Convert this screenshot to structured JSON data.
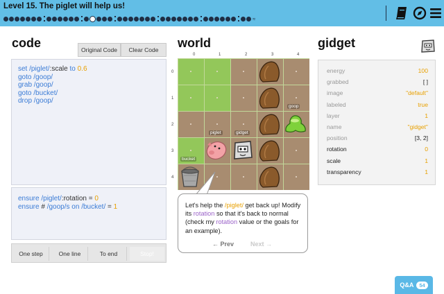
{
  "header": {
    "level_title": "Level 15. The piglet will help us!",
    "progress": {
      "groups": [
        7,
        6,
        5,
        7,
        7,
        6,
        2
      ],
      "current_group": 2,
      "current_index": 1
    },
    "icons": [
      "book-icon",
      "compass-icon",
      "menu-icon"
    ]
  },
  "code_panel": {
    "title": "code",
    "original_code_label": "Original Code",
    "clear_code_label": "Clear Code",
    "lines": [
      {
        "kw": "set",
        "txt": "/piglet/",
        "dk": ":scale",
        "kw2": "to",
        "num": "0.6"
      },
      {
        "kw": "goto",
        "txt": "/goop/"
      },
      {
        "kw": "grab",
        "txt": "/goop/"
      },
      {
        "kw": "goto",
        "txt": "/bucket/"
      },
      {
        "kw": "drop",
        "txt": "/goop/"
      }
    ],
    "ensure_lines": [
      {
        "kw": "ensure",
        "txt": "/piglet/",
        "dk": ":rotation",
        "eq": "=",
        "num": "0"
      },
      {
        "kw": "ensure",
        "dk": "#",
        "txt": "/goop/s",
        "kw2": "on",
        "txt2": "/bucket/",
        "eq": "=",
        "num": "1"
      }
    ],
    "controls": [
      "One step",
      "One line",
      "To end",
      "Stop!"
    ]
  },
  "world": {
    "title": "world",
    "col_numbers": [
      "0",
      "1",
      "2",
      "3",
      "4"
    ],
    "row_numbers": [
      "0",
      "1",
      "2",
      "3",
      "4"
    ],
    "labels": {
      "goop": "goop",
      "piglet": "piglet",
      "gidget": "gidget",
      "bucket": "bucket"
    }
  },
  "bubble": {
    "p1": "Let's help the ",
    "piglet": "/piglet/",
    "p2": " get back up! Modify its ",
    "rot1": "rotation",
    "p3": " so that it's back to normal (check my ",
    "rot2": "rotation",
    "p4": " value or the goals for an example).",
    "prev": "← Prev",
    "next": "Next →"
  },
  "gidget": {
    "title": "gidget",
    "props": [
      {
        "name": "energy",
        "value": "100"
      },
      {
        "name": "grabbed",
        "value": "[ ]"
      },
      {
        "name": "image",
        "value": "\"default\""
      },
      {
        "name": "labeled",
        "value": "true"
      },
      {
        "name": "layer",
        "value": "1"
      },
      {
        "name": "name",
        "value": "\"gidget\""
      },
      {
        "name": "position",
        "value": "[3, 2]"
      },
      {
        "name": "rotation",
        "value": "0"
      },
      {
        "name": "scale",
        "value": "1"
      },
      {
        "name": "transparency",
        "value": "1"
      }
    ]
  },
  "qa": {
    "label": "Q&A",
    "count": "54"
  }
}
